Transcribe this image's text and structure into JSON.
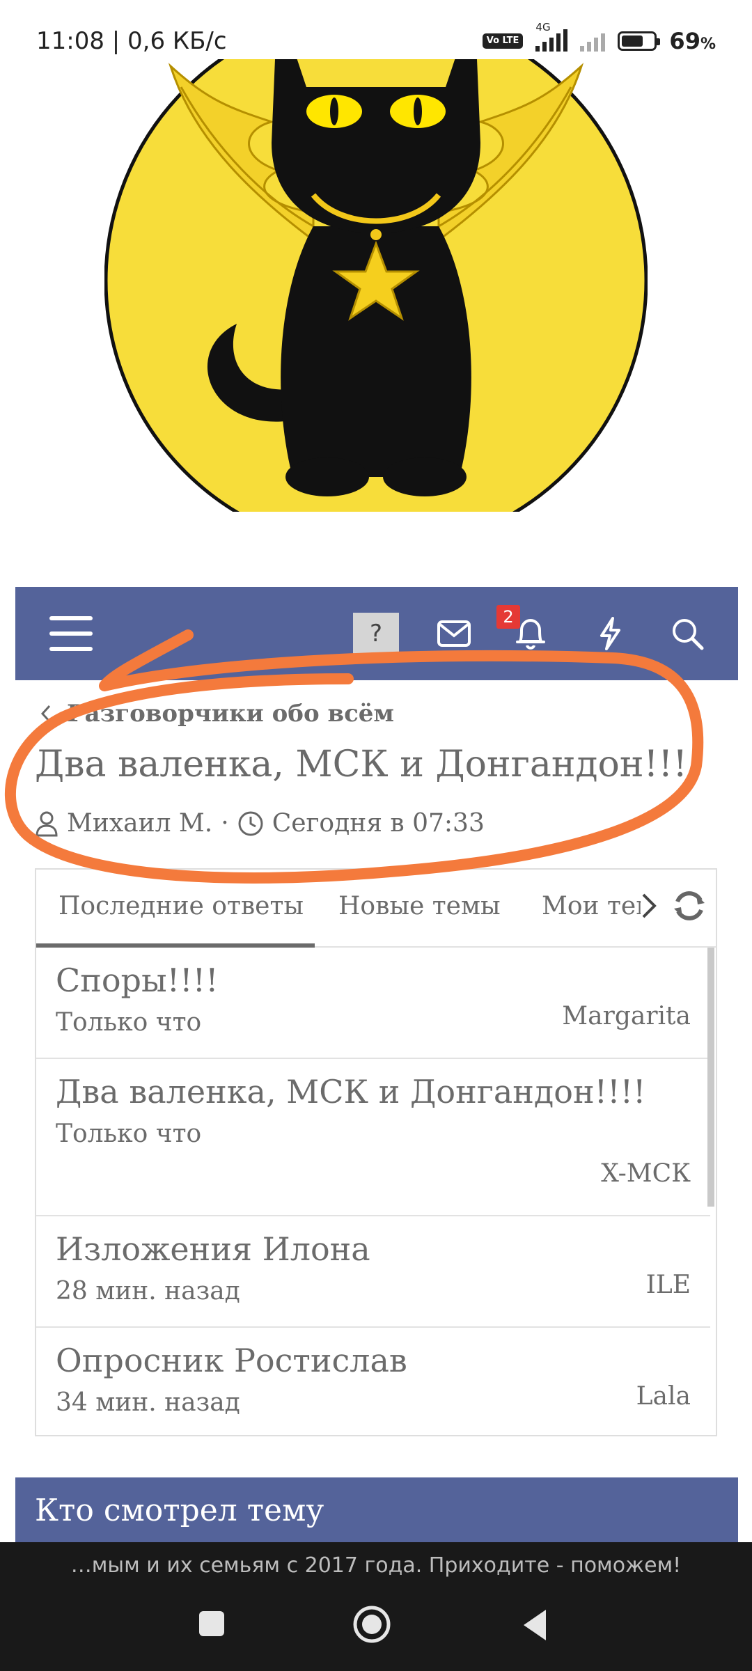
{
  "status_bar": {
    "time": "11:08 | 0,6 КБ/с",
    "volte": "Vo LTE",
    "network": "4G",
    "battery_percent": "69",
    "battery_level": 0.69
  },
  "logo": {
    "icon": "winged-black-cat-logo",
    "colors": {
      "circle": "#f7dd3a",
      "cat": "#111111",
      "wings": "#f3d12a"
    }
  },
  "navbar": {
    "background": "#54639a",
    "help_label": "?",
    "notification_count": "2",
    "icons": [
      "menu-icon",
      "envelope-icon",
      "bell-icon",
      "lightning-icon",
      "search-icon"
    ]
  },
  "thread": {
    "breadcrumb": "Разговорчики обо всём",
    "title": "Два валенка, МСК и Донгандон!!!!",
    "author": "Михаил М.",
    "separator": "·",
    "date": "Сегодня в 07:33"
  },
  "widget": {
    "tabs": [
      {
        "label": "Последние ответы"
      },
      {
        "label": "Новые темы"
      },
      {
        "label": "Мои темы"
      }
    ],
    "items": [
      {
        "title": "Споры!!!!",
        "time": "Только что",
        "user": "Margarita"
      },
      {
        "title": "Два валенка, МСК и Донгандон!!!!",
        "time": "Только что",
        "user": "X-МСК"
      },
      {
        "title": "Изложения Илона",
        "time": "28 мин. назад",
        "user": "ILE"
      },
      {
        "title": "Опросник Ростислав",
        "time": "34 мин. назад",
        "user": "Lala"
      }
    ]
  },
  "viewers": {
    "title": "Кто смотрел тему"
  },
  "footer": {
    "text": "…мым и их семьям с 2017 года. Приходите - поможем!"
  },
  "annotation": {
    "color": "#f47a3c"
  }
}
